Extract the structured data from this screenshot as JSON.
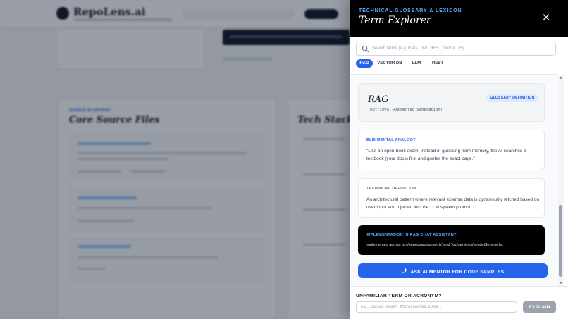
{
  "drawer": {
    "kicker": "TECHNICAL GLOSSARY & LEXICON",
    "title": "Term Explorer",
    "close_icon": "close-icon"
  },
  "search": {
    "placeholder": "Search terms (e.g. RAG, JWT, REST, Vector DB)...",
    "value": ""
  },
  "tabs": [
    {
      "label": "RAG",
      "active": true
    },
    {
      "label": "VECTOR DB",
      "active": false
    },
    {
      "label": "LLM",
      "active": false
    },
    {
      "label": "REST",
      "active": false
    }
  ],
  "term": {
    "name": "RAG",
    "full": "(Retrieval-Augmented Generation)",
    "badge": "GLOSSARY DEFINITION"
  },
  "analogy": {
    "kicker": "ELI5 MENTAL ANALOGY",
    "text": "\"Like an open-book exam: instead of guessing from memory, the AI searches a textbook (your docs) first and quotes the exact page.\""
  },
  "technical": {
    "kicker": "TECHNICAL DEFINITION",
    "text": "An architectural pattern where relevant external data is dynamically fetched based on user input and injected into the LLM system prompt."
  },
  "implementation": {
    "kicker": "IMPLEMENTATION IN RAG CHAT ASSISTANT",
    "text": "Implemented across 'src/services/chunker.ts' and 'src/services/geminiService.ts'."
  },
  "ask_button": {
    "label": "ASK AI MENTOR FOR CODE SAMPLES",
    "icon": "sparkle-icon"
  },
  "footer": {
    "label": "UNFAMILIAR TERM OR ACRONYM?",
    "placeholder": "e.g., Docker, OAuth, Microservices, ORM...",
    "value": "",
    "button": "EXPLAIN"
  },
  "background": {
    "brand": "RepoLens.ai",
    "panel_kicker": "SOURCE BLUEPRINT",
    "panel_title": "Core Source Files",
    "panel2_title": "Tech Stack &"
  },
  "colors": {
    "accent": "#2563eb",
    "header_bg": "#000000",
    "kicker_blue": "#60a5fa",
    "badge_bg": "#dbeafe"
  }
}
